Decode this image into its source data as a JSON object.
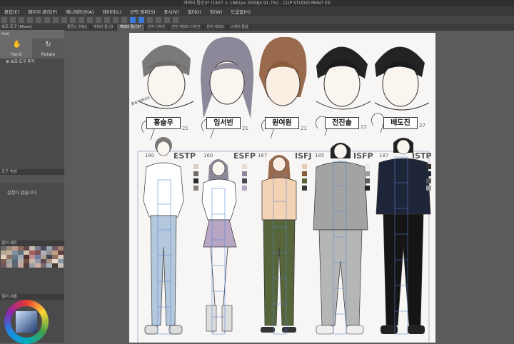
{
  "window": {
    "title": "캐릭터 통신3* (1827 × 1882px 300dpi 91.7%)  - CLIP STUDIO PAINT EX"
  },
  "menu": [
    "편집(E)",
    "페이지 관리(P)",
    "애니메이션(A)",
    "레이어(L)",
    "선택 범위(S)",
    "표시(V)",
    "필터(I)",
    "창(W)",
    "도움말(H)"
  ],
  "tool_panel": {
    "header": "보조 도구 [Move]",
    "mode": "ove",
    "tools": [
      {
        "label": "Hand",
        "icon": "hand-icon"
      },
      {
        "label": "Rotate",
        "icon": "rotate-icon"
      }
    ],
    "add_subtool": "보조 도구 추가"
  },
  "property_panel": {
    "header": "도구 속성",
    "empty_text": "설정이 없습니다."
  },
  "color_panel": {
    "header": "컬러 서클",
    "swatch_header": "컬러 세트",
    "swatches": [
      "#6a6a6a",
      "#9c8a7c",
      "#b79a8a",
      "#8a6a5a",
      "#5a4a4a",
      "#c8b8b0",
      "#7a7a8a",
      "#4a4a5a",
      "#9aa0b0",
      "#705860",
      "#a08070",
      "#b8a890",
      "#c0b0a0",
      "#8090a0",
      "#607080",
      "#d0c0b0",
      "#a06060",
      "#7a5050",
      "#b0b0c0",
      "#909090",
      "#c0a080",
      "#604040",
      "#e0d0c0",
      "#8a7060",
      "#6a7a8a",
      "#a0a8b8",
      "#503030",
      "#c09090",
      "#7080a0",
      "#b0a090",
      "#404850",
      "#907060",
      "#d8c8b8",
      "#806050",
      "#a0a0a0",
      "#586878",
      "#b8b0a8",
      "#705040",
      "#c8b8a8",
      "#909aa8",
      "#604850",
      "#a89080",
      "#e8d8c8",
      "#8898a8",
      "#705860",
      "#b0a0a0",
      "#606870",
      "#c0a8a0",
      "#504040",
      "#98a0a8",
      "#d0b0a0",
      "#7a6a6a",
      "#a8b0b8",
      "#483838",
      "#c8c0b8"
    ]
  },
  "document_tabs": [
    "물론스 원래2",
    "캐릭터 통신2",
    "캐릭터 통신3*",
    "원자 디자인",
    "전진 캐릭터 디자인",
    "원자 캐릭터",
    "스케치 통합"
  ],
  "sheet": {
    "characters": [
      {
        "name": "홍슬우",
        "mbti": "ESTP",
        "height_note": "180",
        "age": "21",
        "colors": [
          "#d9cfc4",
          "#6f6a66",
          "#2b2b2b",
          "#8a7f77"
        ]
      },
      {
        "name": "임서빈",
        "mbti": "ESFP",
        "height_note": "160",
        "age": "21",
        "colors": [
          "#e6dcd2",
          "#8d8899",
          "#4b4752",
          "#b7a7c4"
        ]
      },
      {
        "name": "원여원",
        "mbti": "ISFJ",
        "height_note": "167",
        "age": "21",
        "colors": [
          "#e8cdb5",
          "#8a5a3c",
          "#56663a",
          "#3a3a3a"
        ]
      },
      {
        "name": "전진솔",
        "mbti": "ISFP",
        "height_note": "185",
        "age": "22",
        "colors": [
          "#e9e9e9",
          "#9a9a9a",
          "#5c5c5c",
          "#222222"
        ]
      },
      {
        "name": "배도진",
        "mbti": "ISTP",
        "height_note": "187",
        "age": "27",
        "colors": [
          "#2e2e2e",
          "#1f2538",
          "#575757",
          "#9a9a9a"
        ]
      }
    ],
    "signature": "홍슬우배대리"
  }
}
